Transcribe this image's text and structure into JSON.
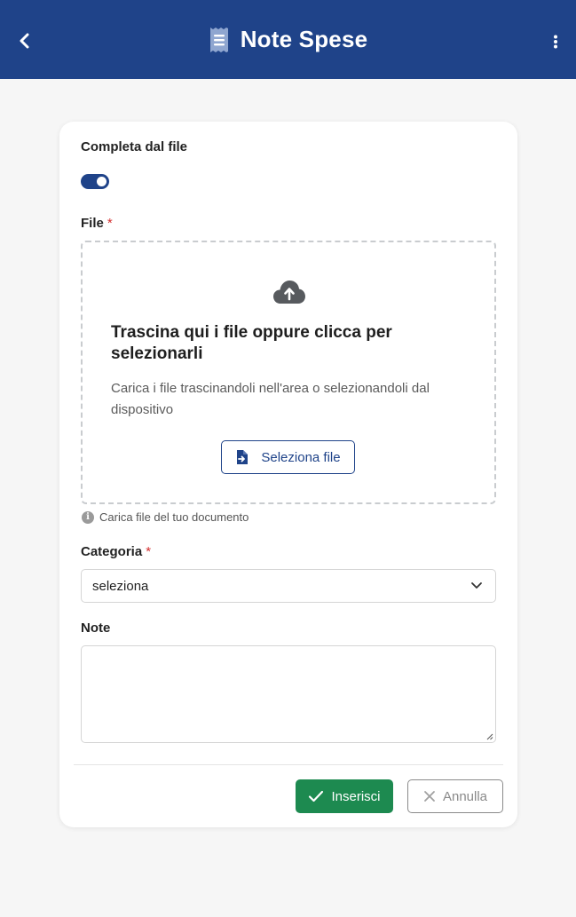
{
  "header": {
    "title": "Note Spese",
    "back_icon": "chevron-left-icon",
    "title_icon": "receipt-icon",
    "menu_icon": "vertical-dots-icon",
    "background": "#1f4389"
  },
  "form": {
    "autofill": {
      "label": "Completa dal file",
      "enabled": true
    },
    "file": {
      "label": "File",
      "required_mark": "*",
      "dropzone_title": "Trascina qui i file oppure clicca per selezionarli",
      "dropzone_description": "Carica i file trascinandoli nell'area o selezionandoli dal dispositivo",
      "select_button": "Seleziona file",
      "hint": "Carica file del tuo documento"
    },
    "category": {
      "label": "Categoria",
      "required_mark": "*",
      "selected": "seleziona"
    },
    "notes": {
      "label": "Note",
      "value": ""
    }
  },
  "actions": {
    "insert_label": "Inserisci",
    "cancel_label": "Annulla",
    "insert_color": "#1d8a50"
  }
}
